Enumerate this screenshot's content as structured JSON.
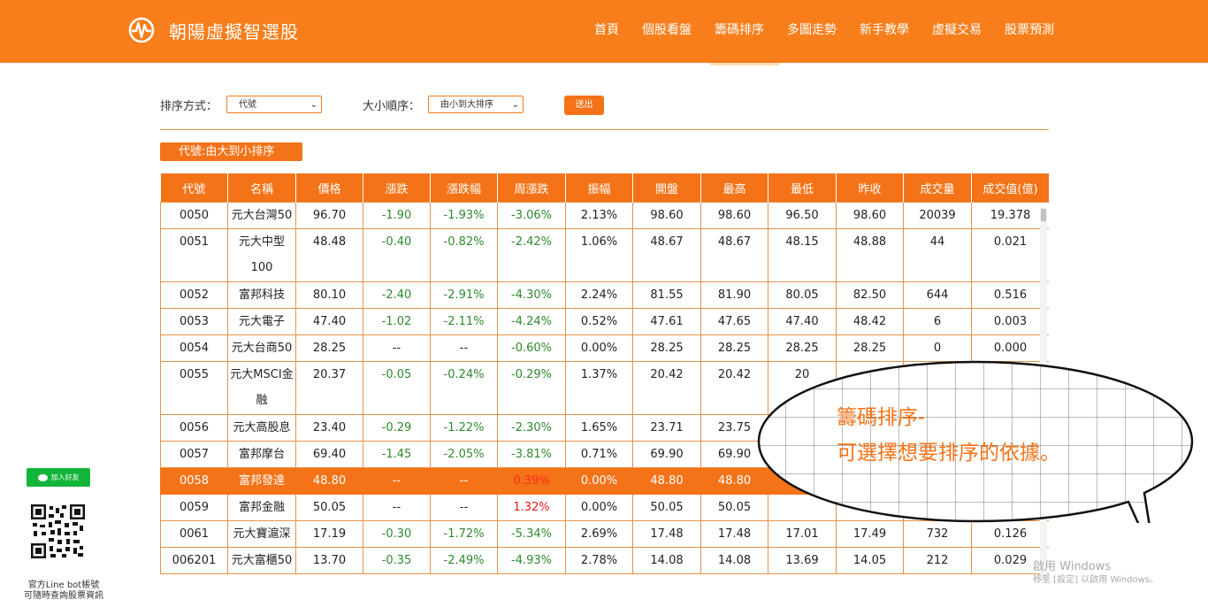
{
  "brand": {
    "name": "朝陽虛擬智選股"
  },
  "nav": [
    {
      "label": "首頁"
    },
    {
      "label": "個股看盤"
    },
    {
      "label": "籌碼排序"
    },
    {
      "label": "多圖走勢"
    },
    {
      "label": "新手教學"
    },
    {
      "label": "虛擬交易"
    },
    {
      "label": "股票預測"
    }
  ],
  "controls": {
    "sort_by_label": "排序方式：",
    "sort_by_value": "代號",
    "order_label": "大小順序：",
    "order_value": "由小到大排序",
    "submit_label": "送出"
  },
  "sort_badge": "代號:由大到小排序",
  "table": {
    "headers": [
      "代號",
      "名稱",
      "價格",
      "漲跌",
      "漲跌幅",
      "周漲跌",
      "振幅",
      "開盤",
      "最高",
      "最低",
      "昨收",
      "成交量",
      "成交值(億)"
    ],
    "rows": [
      [
        "0050",
        "元大台灣50",
        "96.70",
        "-1.90",
        "-1.93%",
        "-3.06%",
        "2.13%",
        "98.60",
        "98.60",
        "96.50",
        "98.60",
        "20039",
        "19.378"
      ],
      [
        "0051",
        "元大中型100",
        "48.48",
        "-0.40",
        "-0.82%",
        "-2.42%",
        "1.06%",
        "48.67",
        "48.67",
        "48.15",
        "48.88",
        "44",
        "0.021"
      ],
      [
        "0052",
        "富邦科技",
        "80.10",
        "-2.40",
        "-2.91%",
        "-4.30%",
        "2.24%",
        "81.55",
        "81.90",
        "80.05",
        "82.50",
        "644",
        "0.516"
      ],
      [
        "0053",
        "元大電子",
        "47.40",
        "-1.02",
        "-2.11%",
        "-4.24%",
        "0.52%",
        "47.61",
        "47.65",
        "47.40",
        "48.42",
        "6",
        "0.003"
      ],
      [
        "0054",
        "元大台商50",
        "28.25",
        "--",
        "--",
        "-0.60%",
        "0.00%",
        "28.25",
        "28.25",
        "28.25",
        "28.25",
        "0",
        "0.000"
      ],
      [
        "0055",
        "元大MSCI金融",
        "20.37",
        "-0.05",
        "-0.24%",
        "-0.29%",
        "1.37%",
        "20.42",
        "20.42",
        "20",
        "",
        "",
        ""
      ],
      [
        "0056",
        "元大高股息",
        "23.40",
        "-0.29",
        "-1.22%",
        "-2.30%",
        "1.65%",
        "23.71",
        "23.75",
        "",
        "",
        "",
        ""
      ],
      [
        "0057",
        "富邦摩台",
        "69.40",
        "-1.45",
        "-2.05%",
        "-3.81%",
        "0.71%",
        "69.90",
        "69.90",
        "",
        "",
        "",
        ""
      ],
      [
        "0058",
        "富邦發達",
        "48.80",
        "--",
        "--",
        "0.39%",
        "0.00%",
        "48.80",
        "48.80",
        "",
        "",
        "",
        ""
      ],
      [
        "0059",
        "富邦金融",
        "50.05",
        "--",
        "--",
        "1.32%",
        "0.00%",
        "50.05",
        "50.05",
        "",
        "",
        "",
        ""
      ],
      [
        "0061",
        "元大寶滬深",
        "17.19",
        "-0.30",
        "-1.72%",
        "-5.34%",
        "2.69%",
        "17.48",
        "17.48",
        "17.01",
        "17.49",
        "732",
        "0.126"
      ],
      [
        "006201",
        "元大富櫃50",
        "13.70",
        "-0.35",
        "-2.49%",
        "-4.93%",
        "2.78%",
        "14.08",
        "14.08",
        "13.69",
        "14.05",
        "212",
        "0.029"
      ]
    ]
  },
  "callout": {
    "line1": "籌碼排序-",
    "line2": "可選擇想要排序的依據。"
  },
  "sidebar": {
    "line_button": "加入好友",
    "caption_line1": "官方Line bot帳號",
    "caption_line2": "可隨時查詢股票資訊"
  },
  "watermark": {
    "line1": "啟用 Windows",
    "line2": "移至 [設定] 以啟用 Windows。"
  },
  "colors": {
    "brand": "#f77e1b",
    "down": "#2e8a2e",
    "up": "#e0201b",
    "line_green": "#11b53a"
  }
}
